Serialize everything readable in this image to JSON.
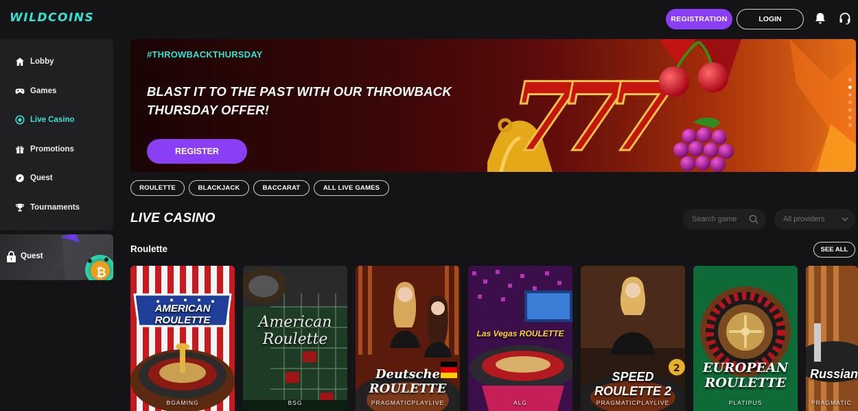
{
  "header": {
    "logo": "WILDCOINS",
    "registration_label": "REGISTRATION",
    "login_label": "LOGIN",
    "icons": [
      "bell-icon",
      "headset-icon"
    ]
  },
  "sidebar": {
    "items": [
      {
        "label": "Lobby",
        "icon": "home-icon",
        "active": false
      },
      {
        "label": "Games",
        "icon": "gamepad-icon",
        "active": false
      },
      {
        "label": "Live Casino",
        "icon": "live-icon",
        "active": true
      },
      {
        "label": "Promotions",
        "icon": "gift-icon",
        "active": false
      },
      {
        "label": "Quest",
        "icon": "quest-icon",
        "active": false
      },
      {
        "label": "Tournaments",
        "icon": "trophy-icon",
        "active": false
      }
    ],
    "quest_card": {
      "label": "Quest",
      "icon": "lock-icon"
    }
  },
  "banner": {
    "tag": "#THROWBACKTHURSDAY",
    "title": "BLAST IT TO THE PAST WITH OUR THROWBACK THURSDAY OFFER!",
    "button": "REGISTER",
    "slide_count": 7,
    "active_slide": 2
  },
  "chips": [
    "ROULETTE",
    "BLACKJACK",
    "BACCARAT",
    "ALL LIVE GAMES"
  ],
  "section": {
    "title": "LIVE CASINO",
    "search_placeholder": "Search game",
    "providers_label": "All providers"
  },
  "roulette": {
    "title": "Roulette",
    "see_all": "SEE ALL",
    "games": [
      {
        "art": "AMERICAN ROULETTE",
        "provider": "BGAMING"
      },
      {
        "art": "American Roulette",
        "provider": "BSG"
      },
      {
        "art": "Deutsche ROULETTE",
        "provider": "PRAGMATICPLAYLIVE"
      },
      {
        "art": "Las Vegas ROULETTE",
        "provider": "ALG"
      },
      {
        "art": "SPEED ROULETTE 2",
        "provider": "PRAGMATICPLAYLIVE"
      },
      {
        "art": "EUROPEAN ROULETTE",
        "provider": "PLATIPUS"
      },
      {
        "art": "Russian ROU",
        "provider": "PRAGMATIC"
      }
    ]
  },
  "colors": {
    "accent": "#8b3ff5",
    "teal": "#37e0d3",
    "background": "#141416",
    "panel": "#202023"
  }
}
